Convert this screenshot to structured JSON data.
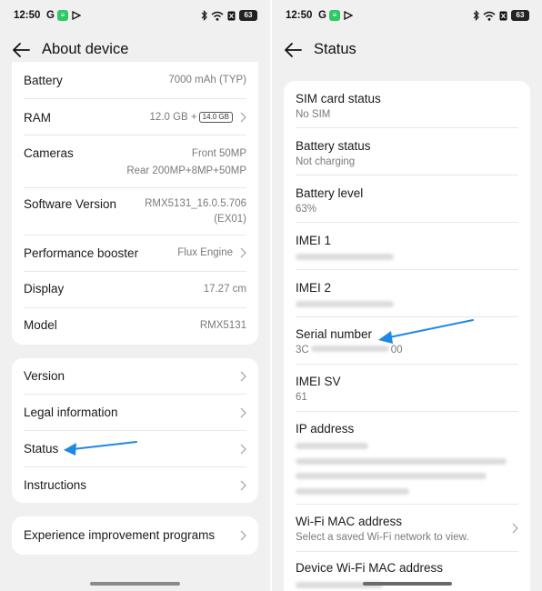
{
  "colors": {
    "accent_arrow": "#1e88e5",
    "screen_bg": "#f0f0f0",
    "card_bg": "#ffffff"
  },
  "left": {
    "status_bar": {
      "time": "12:50",
      "g_letter": "G",
      "battery": "63"
    },
    "header": {
      "title": "About device"
    },
    "info_rows": [
      {
        "label": "Battery",
        "value": "7000 mAh (TYP)"
      },
      {
        "label": "RAM",
        "value": "12.0 GB +",
        "chip": "14.0 GB"
      },
      {
        "label": "Cameras",
        "value_line1": "Front 50MP",
        "value_line2": "Rear 200MP+8MP+50MP"
      },
      {
        "label": "Software Version",
        "value_line1": "RMX5131_16.0.5.706",
        "value_line2": "(EX01)"
      },
      {
        "label": "Performance booster",
        "value": "Flux Engine"
      },
      {
        "label": "Display",
        "value": "17.27 cm"
      },
      {
        "label": "Model",
        "value": "RMX5131"
      }
    ],
    "nav_rows": [
      {
        "label": "Version"
      },
      {
        "label": "Legal information"
      },
      {
        "label": "Status"
      },
      {
        "label": "Instructions"
      }
    ],
    "extra_row": {
      "label": "Experience improvement programs"
    }
  },
  "right": {
    "status_bar": {
      "time": "12:50",
      "g_letter": "G",
      "battery": "63"
    },
    "header": {
      "title": "Status"
    },
    "rows": [
      {
        "title": "SIM card status",
        "sub": "No SIM"
      },
      {
        "title": "Battery status",
        "sub": "Not charging"
      },
      {
        "title": "Battery level",
        "sub": "63%"
      },
      {
        "title": "IMEI 1"
      },
      {
        "title": "IMEI 2"
      },
      {
        "title": "Serial number",
        "sub_prefix": "3C",
        "sub_suffix": "00"
      },
      {
        "title": "IMEI SV",
        "sub": "61"
      },
      {
        "title": "IP address"
      },
      {
        "title": "Wi-Fi MAC address",
        "sub": "Select a saved Wi-Fi network to view."
      },
      {
        "title": "Device Wi-Fi MAC address"
      }
    ]
  }
}
